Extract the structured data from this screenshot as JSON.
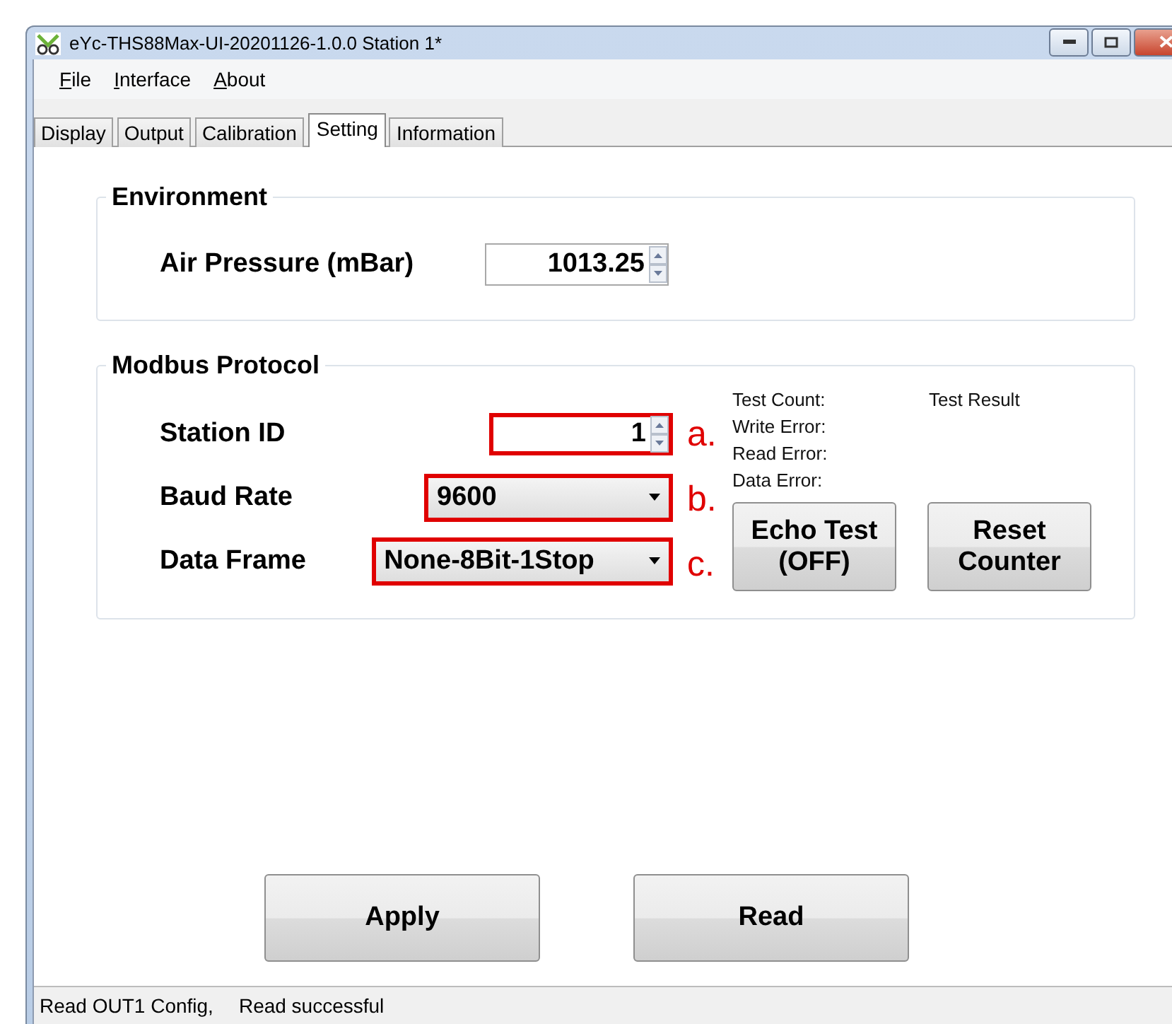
{
  "window": {
    "title": "eYc-THS88Max-UI-20201126-1.0.0  Station 1*"
  },
  "menu": [
    {
      "label": "File"
    },
    {
      "label": "Interface"
    },
    {
      "label": "About"
    }
  ],
  "tabs": [
    {
      "label": "Display",
      "selected": false
    },
    {
      "label": "Output",
      "selected": false
    },
    {
      "label": "Calibration",
      "selected": false
    },
    {
      "label": "Setting",
      "selected": true
    },
    {
      "label": "Information",
      "selected": false
    }
  ],
  "environment": {
    "title": "Environment",
    "fields": [
      {
        "label": "Air Pressure (mBar)",
        "kind": "spin",
        "value": "1013.25",
        "highlighted": false
      }
    ]
  },
  "modbus": {
    "title": "Modbus Protocol",
    "fields": [
      {
        "label": "Station ID",
        "kind": "spin",
        "value": "1",
        "highlighted": true,
        "annotation": "a."
      },
      {
        "label": "Baud Rate",
        "kind": "combo",
        "value": "9600",
        "highlighted": true,
        "annotation": "b."
      },
      {
        "label": "Data Frame",
        "kind": "combo",
        "value": "None-8Bit-1Stop",
        "highlighted": true,
        "annotation": "c."
      }
    ],
    "test_lines": [
      "Test Count:",
      "Write Error:",
      "Read Error:",
      "Data Error:"
    ],
    "test_result": "Test Result",
    "buttons": [
      "Echo Test (OFF)",
      "Reset Counter"
    ]
  },
  "actions": [
    "Apply",
    "Read"
  ],
  "status_bar": [
    "Read OUT1 Config,",
    "Read successful"
  ]
}
